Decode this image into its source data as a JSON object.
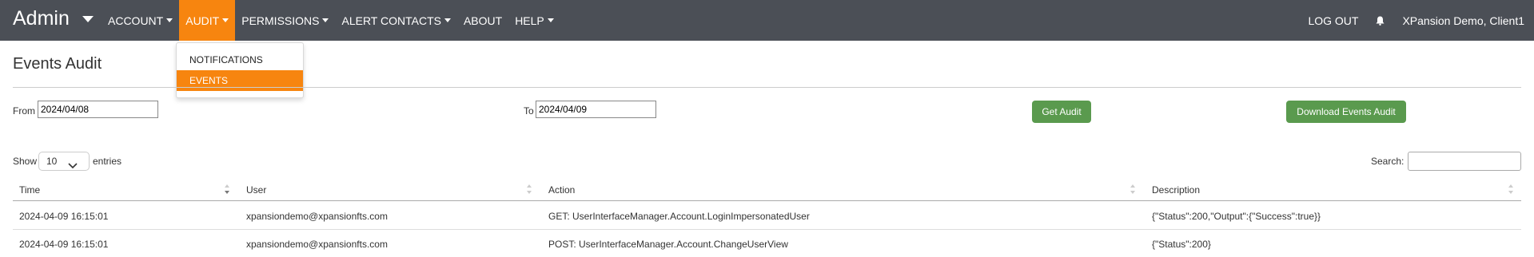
{
  "brand": {
    "title": "Admin"
  },
  "nav": {
    "items": [
      "ACCOUNT",
      "AUDIT",
      "PERMISSIONS",
      "ALERT CONTACTS",
      "ABOUT",
      "HELP"
    ],
    "active": "AUDIT",
    "logout": "LOG OUT",
    "user": "XPansion Demo, Client1"
  },
  "audit_menu": {
    "items": [
      "NOTIFICATIONS",
      "EVENTS"
    ],
    "active": "EVENTS"
  },
  "page": {
    "title": "Events Audit"
  },
  "filters": {
    "from_label": "From",
    "from_value": "2024/04/08",
    "to_label": "To",
    "to_value": "2024/04/09",
    "get_audit": "Get Audit",
    "download": "Download Events Audit"
  },
  "table_controls": {
    "show_label": "Show",
    "entries_value": "10",
    "entries_label": "entries",
    "search_label": "Search:",
    "search_value": ""
  },
  "table": {
    "columns": [
      "Time",
      "User",
      "Action",
      "Description"
    ],
    "rows": [
      [
        "2024-04-09 16:15:01",
        "xpansiondemo@xpansionfts.com",
        "GET: UserInterfaceManager.Account.LoginImpersonatedUser",
        "{\"Status\":200,\"Output\":{\"Success\":true}}"
      ],
      [
        "2024-04-09 16:15:01",
        "xpansiondemo@xpansionfts.com",
        "POST: UserInterfaceManager.Account.ChangeUserView",
        "{\"Status\":200}"
      ]
    ]
  },
  "colors": {
    "navbar": "#4b4f56",
    "accent": "#f7850f",
    "button": "#5a9a4e"
  },
  "icons": {
    "bell": "bell-icon",
    "sort": "sort-icon",
    "chevron": "chevron-down-icon"
  }
}
